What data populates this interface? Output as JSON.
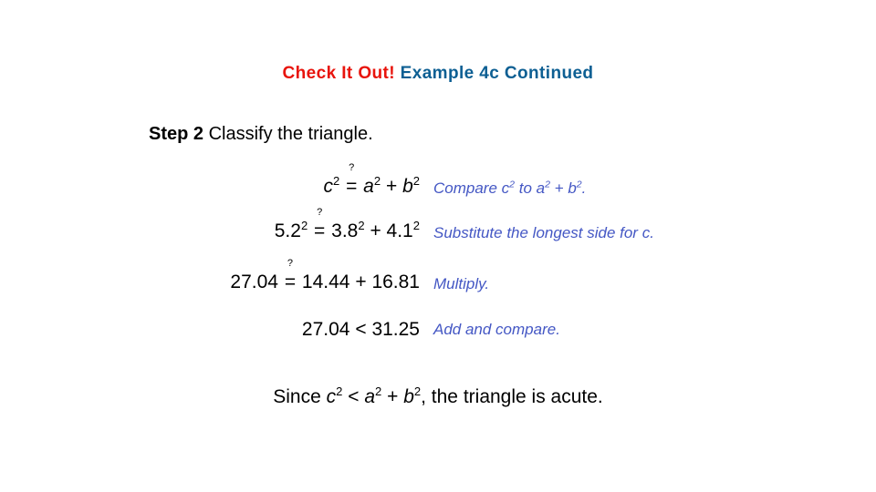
{
  "slide": {
    "title": {
      "highlight": "Check It Out!",
      "rest": "Example 4c Continued",
      "highlight_color": "#e8140c",
      "rest_color": "#0d5f93"
    },
    "step": {
      "label": "Step 2",
      "text": "Classify the triangle."
    },
    "note_color": "#4457c4",
    "rows": [
      {
        "equation_plain": "c2 =? a2 + b2",
        "lhs": "c",
        "lhs_exp": "2",
        "relation": "=",
        "relation_mark": "?",
        "rhs_a": "a",
        "rhs_a_exp": "2",
        "operator": "+",
        "rhs_b": "b",
        "rhs_b_exp": "2",
        "note": "Compare c2 to a2 + b2.",
        "note_parts": {
          "lead": "Compare ",
          "v1": "c",
          "v1_exp": "2",
          "mid": " to ",
          "v2": "a",
          "v2_exp": "2",
          "op": " + ",
          "v3": "b",
          "v3_exp": "2",
          "tail": "."
        }
      },
      {
        "equation_plain": "5.22 =? 3.82 + 4.12",
        "lhs": "5.2",
        "lhs_exp": "2",
        "relation": "=",
        "relation_mark": "?",
        "rhs_a": "3.8",
        "rhs_a_exp": "2",
        "operator": "+",
        "rhs_b": "4.1",
        "rhs_b_exp": "2",
        "note": "Substitute the longest side for c."
      },
      {
        "equation_plain": "27.04 =? 14.44 + 16.81",
        "lhs": "27.04",
        "lhs_exp": "",
        "relation": "=",
        "relation_mark": "?",
        "rhs_a": "14.44",
        "rhs_a_exp": "",
        "operator": "+",
        "rhs_b": "16.81",
        "rhs_b_exp": "",
        "note": "Multiply."
      },
      {
        "equation_plain": "27.04 < 31.25",
        "lhs": "27.04",
        "lhs_exp": "",
        "relation": "<",
        "relation_mark": "",
        "rhs_a": "31.25",
        "rhs_a_exp": "",
        "operator": "",
        "rhs_b": "",
        "rhs_b_exp": "",
        "note": "Add and compare."
      }
    ],
    "conclusion": {
      "full": "Since c2 < a2 + b2, the triangle is acute.",
      "lead": "Since ",
      "v1": "c",
      "v1_exp": "2",
      "rel": " < ",
      "v2": "a",
      "v2_exp": "2",
      "op": " + ",
      "v3": "b",
      "v3_exp": "2",
      "tail": ", the triangle is acute."
    }
  }
}
